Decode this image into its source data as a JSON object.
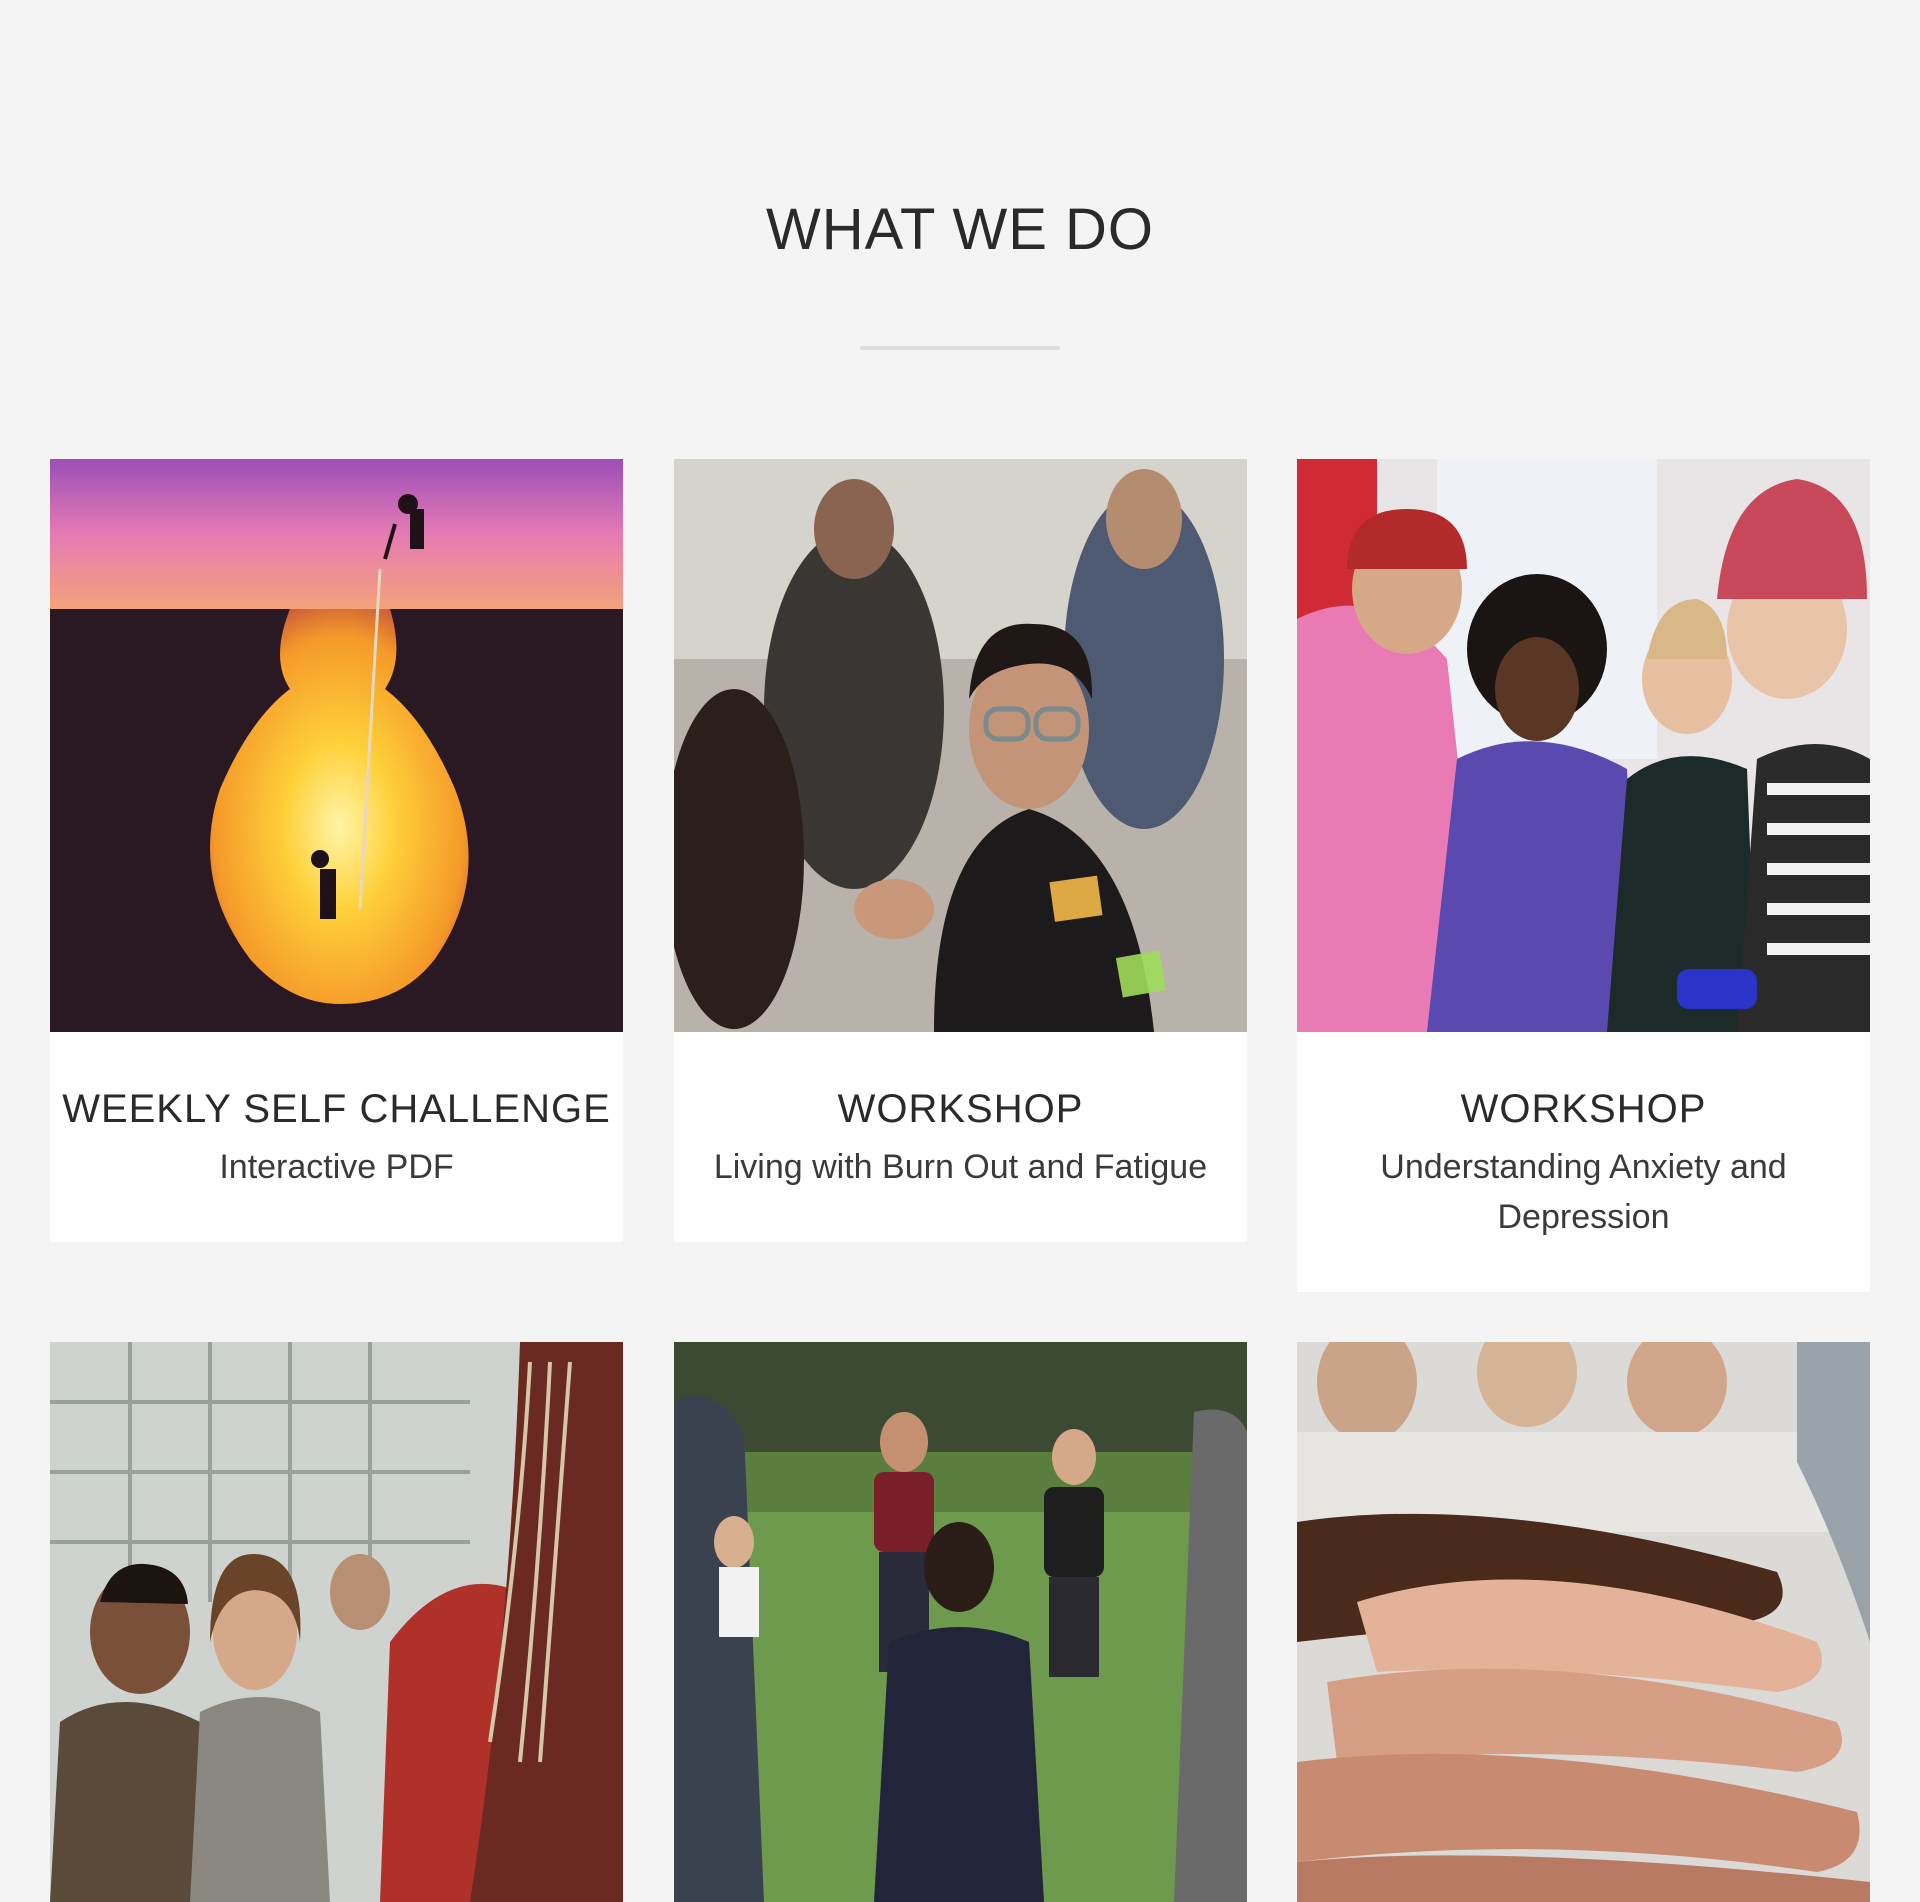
{
  "section": {
    "title": "WHAT WE DO"
  },
  "cards": [
    {
      "heading": "WEEKLY SELF CHALLENGE",
      "subtitle": "Interactive PDF",
      "image": "lightbulb-cliff-silhouette-photo"
    },
    {
      "heading": "WORKSHOP",
      "subtitle": "Living with Burn Out and Fatigue",
      "image": "woman-writing-on-glass-photo"
    },
    {
      "heading": "WORKSHOP",
      "subtitle": "Understanding Anxiety and Depression",
      "image": "group-drawing-together-photo"
    },
    {
      "image": "audience-laughing-photo"
    },
    {
      "image": "people-holding-hands-circle-photo"
    },
    {
      "image": "stacked-hands-teamwork-photo"
    }
  ],
  "colors": {
    "background": "#f4f4f4",
    "card": "#ffffff",
    "text": "#2a2a2a",
    "divider": "#dcdcdc"
  }
}
